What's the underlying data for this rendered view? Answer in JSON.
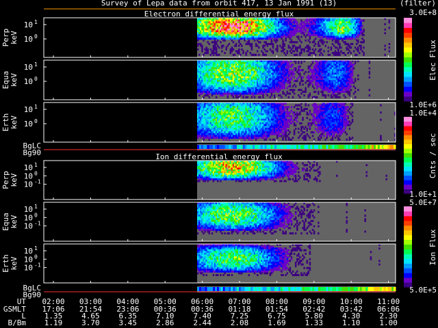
{
  "title": "Survey of Lepa data from orbit 417, 13 Jan 1991 (13)",
  "filter_label": "(filter)",
  "electron_title": "Electron differential energy flux",
  "ion_title": "Ion differential energy flux",
  "colorbars": {
    "elec": {
      "label": "Elec Flux",
      "max": "3.0E+8",
      "min": "1.0E+6"
    },
    "cnts": {
      "label": "Cnts / sec",
      "max": "1.0E+4",
      "min": "1.0E+1"
    },
    "ion": {
      "label": "Ion Flux",
      "max": "5.0E+7",
      "min": "5.0E+5"
    }
  },
  "colors": {
    "background": "#000000",
    "data_gap": "#646464",
    "frame": "#ffffff",
    "title_line": "#ff9a00",
    "strip_red": "#ff3030",
    "scale": [
      "#3c0082",
      "#6a00c8",
      "#0000ff",
      "#0050ff",
      "#00a0ff",
      "#00e6ff",
      "#00ffb4",
      "#00ff50",
      "#40e000",
      "#a0ff00",
      "#ffff00",
      "#ffc800",
      "#ff8c00",
      "#ff4000",
      "#ff0000",
      "#ff3cb4",
      "#ff8cdc"
    ]
  },
  "chart_data": {
    "type": "heatmap",
    "x_axis": {
      "rows": [
        {
          "label": "UT",
          "values": [
            "02:00",
            "03:00",
            "04:00",
            "05:00",
            "06:00",
            "07:00",
            "08:00",
            "09:00",
            "10:00",
            "11:00"
          ]
        },
        {
          "label": "GSMLT",
          "values": [
            "17:06",
            "21:54",
            "23:06",
            "00:36",
            "01:18",
            "01:54",
            "02:42",
            "03:42",
            "06:06"
          ]
        },
        {
          "label": "L",
          "values": [
            "1.35",
            "4.65",
            "6.35",
            "7.10",
            "7.40",
            "7.25",
            "6.75",
            "5.80",
            "4.30",
            "2.30"
          ]
        },
        {
          "label": "B/Bm",
          "values": [
            "1.19",
            "3.70",
            "3.45",
            "2.86",
            "2.44",
            "2.08",
            "1.69",
            "1.33",
            "1.10",
            "1.00"
          ]
        }
      ],
      "gsmlt_display_values": [
        "17:06",
        "21:54",
        "23:06",
        "00:36",
        "01:18",
        "01:54",
        "02:42",
        "03:42",
        "06:06"
      ],
      "gsmlt_shown": [
        "17:06",
        "21:54",
        "23:06",
        "00:36",
        "00:36",
        "01:18",
        "01:54",
        "02:42",
        "03:42",
        "06:06"
      ]
    },
    "panels": [
      {
        "group": "electron",
        "label": [
          "Perp",
          "keV"
        ],
        "yticks": [
          "10^1",
          "10^0"
        ],
        "peak": "red-orange band at ~10^1 keV from 06:00 to 09:00"
      },
      {
        "group": "electron",
        "label": [
          "Equa",
          "keV"
        ],
        "yticks": [
          "10^1",
          "10^0"
        ]
      },
      {
        "group": "electron",
        "label": [
          "Erth",
          "keV"
        ],
        "yticks": [
          "10^1",
          "10^0"
        ]
      },
      {
        "group": "electron",
        "label": [
          "BgLC",
          "Bg90"
        ],
        "type": "strip"
      },
      {
        "group": "ion",
        "label": [
          "Perp",
          "keV"
        ],
        "yticks": [
          "10^1",
          "10^0",
          "10^-1"
        ]
      },
      {
        "group": "ion",
        "label": [
          "Equa",
          "keV"
        ],
        "yticks": [
          "10^1",
          "10^0",
          "10^-1"
        ]
      },
      {
        "group": "ion",
        "label": [
          "Erth",
          "keV"
        ],
        "yticks": [
          "10^1",
          "10^0",
          "10^-1"
        ]
      },
      {
        "group": "ion",
        "label": [
          "BgLC",
          "Bg90"
        ],
        "type": "strip"
      }
    ],
    "data_start_ut": "06:00",
    "data_end_ut": "11:00"
  }
}
